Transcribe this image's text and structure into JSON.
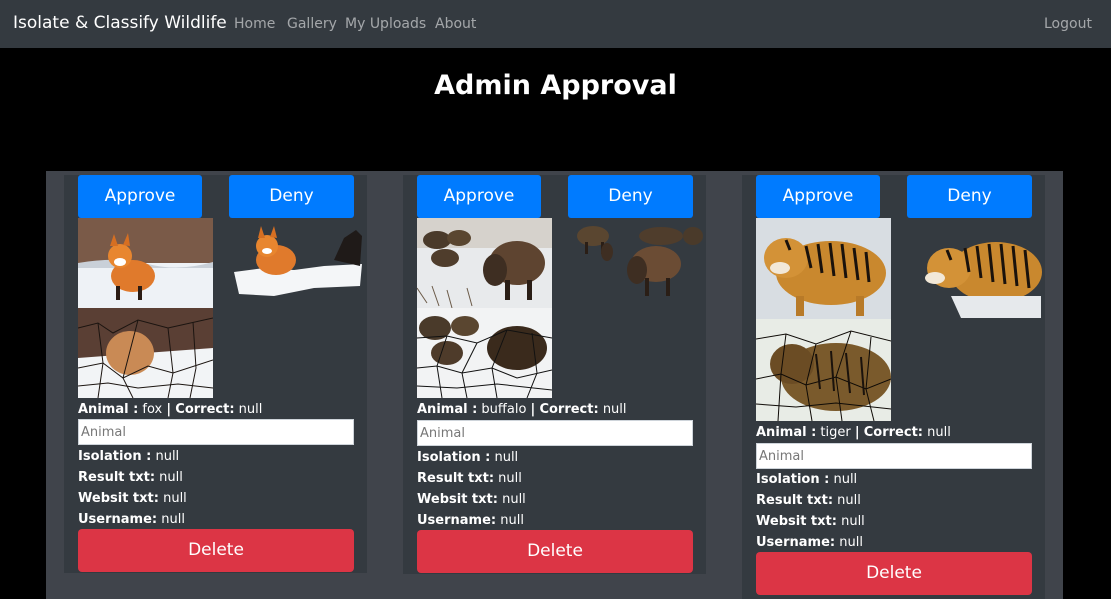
{
  "nav": {
    "brand": "Isolate & Classify Wildlife",
    "links": [
      "Home",
      "Gallery",
      "My Uploads",
      "About"
    ],
    "logout": "Logout"
  },
  "page": {
    "title": "Admin Approval"
  },
  "labels": {
    "approve": "Approve",
    "deny": "Deny",
    "delete": "Delete",
    "animal": "Animal :",
    "sep": "|",
    "correct": "Correct:",
    "isolation": "Isolation :",
    "result": "Result txt:",
    "website": "Websit txt:",
    "username": "Username:",
    "placeholder": "Animal"
  },
  "cards": [
    {
      "animal": "fox",
      "correct": "null",
      "isolation": "null",
      "result": "null",
      "website": "null",
      "username": "null"
    },
    {
      "animal": "buffalo",
      "correct": "null",
      "isolation": "null",
      "result": "null",
      "website": "null",
      "username": "null"
    },
    {
      "animal": "tiger",
      "correct": "null",
      "isolation": "null",
      "result": "null",
      "website": "null",
      "username": "null"
    }
  ],
  "colors": {
    "primary": "#007bff",
    "danger": "#dc3545",
    "navbar": "#343a40"
  }
}
